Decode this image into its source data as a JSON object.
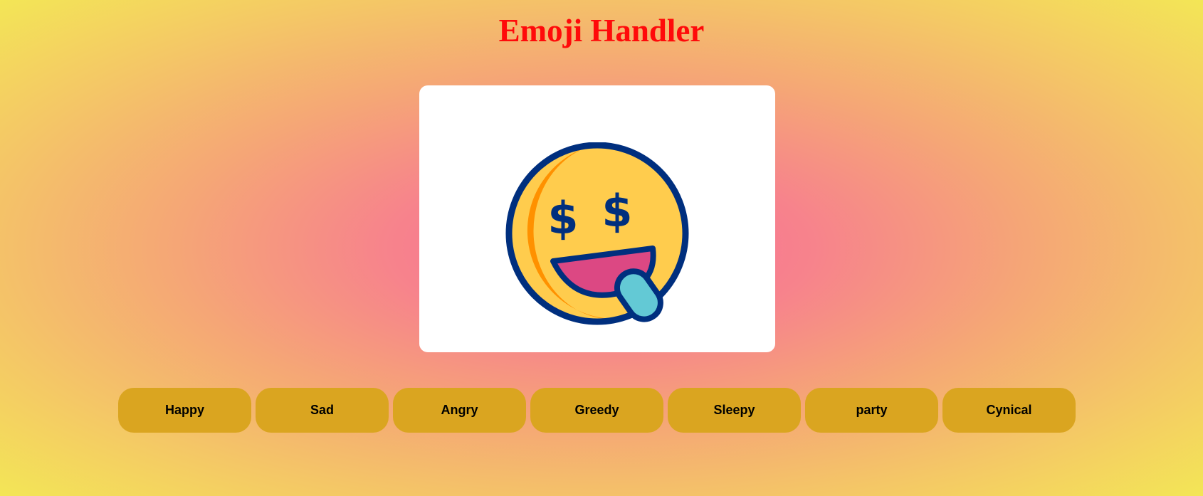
{
  "page": {
    "title": "Emoji Handler"
  },
  "emoji": {
    "icon": "money-mouth-face-icon",
    "colors": {
      "face": "#ffcc4d",
      "shadow": "#ff9100",
      "outline": "#002f7e",
      "mouth": "#dc4883",
      "tongue": "#63c9d5"
    }
  },
  "buttons": [
    {
      "label": "Happy"
    },
    {
      "label": "Sad"
    },
    {
      "label": "Angry"
    },
    {
      "label": "Greedy"
    },
    {
      "label": "Sleepy"
    },
    {
      "label": "party"
    },
    {
      "label": "Cynical"
    }
  ],
  "colors": {
    "title": "#ff0a0a",
    "button_bg": "#daa520",
    "gradient_center": "#f96b96",
    "gradient_edge": "#f3e656"
  }
}
